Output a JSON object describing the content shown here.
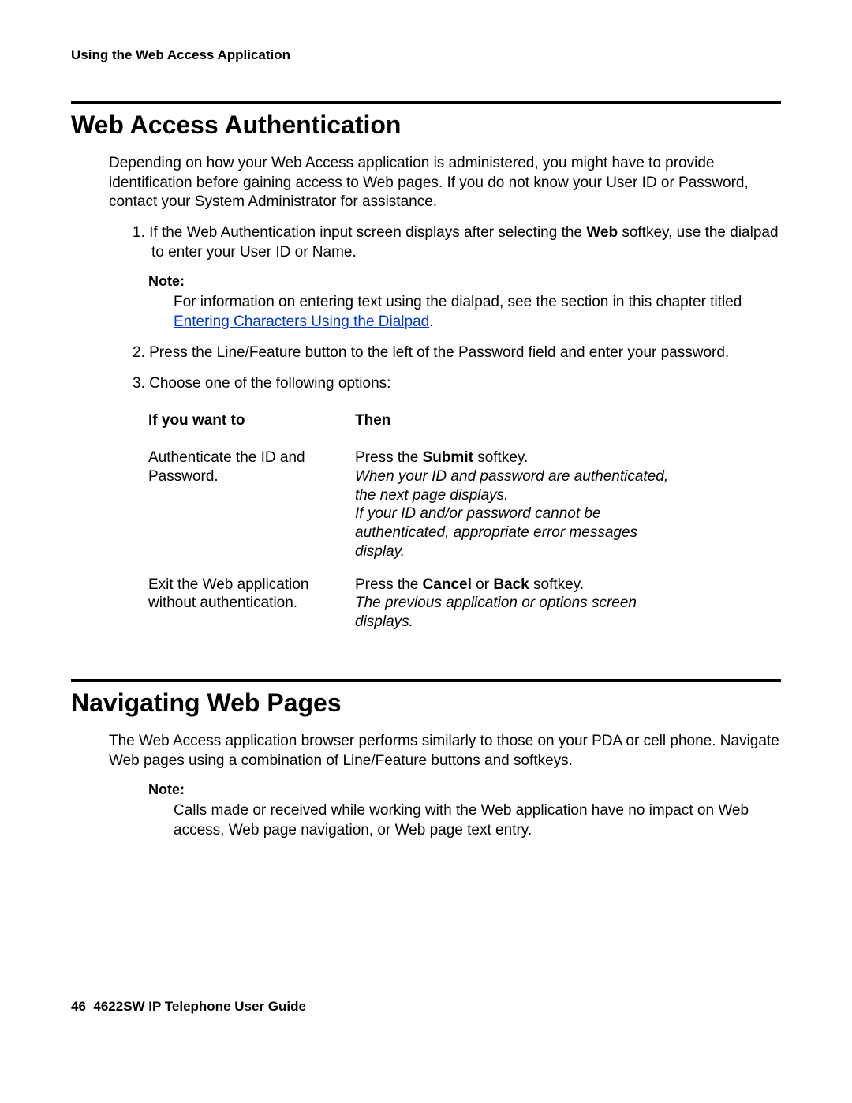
{
  "runningHeader": "Using the Web Access Application",
  "section1": {
    "title": "Web Access Authentication",
    "intro": "Depending on how your Web Access application is administered, you might have to provide identification before gaining access to Web pages. If you do not know your User ID or Password, contact your System Administrator for assistance.",
    "step1_pre": "1. If the Web Authentication input screen displays after selecting the ",
    "step1_bold": "Web",
    "step1_post": " softkey, use the dialpad to enter your User ID or Name.",
    "noteLabel": "Note:",
    "noteBody_pre": "For information on entering text using the dialpad, see the section in this chapter titled ",
    "noteBody_link": "Entering Characters Using the Dialpad",
    "noteBody_post": ".",
    "step2": "2. Press the Line/Feature button to the left of the Password field and enter your password.",
    "step3": "3. Choose one of the following options:",
    "table": {
      "h1": "If you want to",
      "h2": "Then",
      "r1c1": "Authenticate the ID and Password.",
      "r1c2_pre": "Press the ",
      "r1c2_bold": "Submit",
      "r1c2_post": " softkey.",
      "r1c2_it1": "When your ID and password are authenticated, the next page displays.",
      "r1c2_it2": "If your ID and/or password cannot be authenticated, appropriate error messages display.",
      "r2c1": "Exit the Web application without authentication.",
      "r2c2_pre": "Press the ",
      "r2c2_bold1": "Cancel",
      "r2c2_mid": " or ",
      "r2c2_bold2": "Back",
      "r2c2_post": " softkey.",
      "r2c2_it": "The previous application or options screen displays."
    }
  },
  "section2": {
    "title": "Navigating Web Pages",
    "intro": "The Web Access application browser performs similarly to those on your PDA or cell phone. Navigate Web pages using a combination of Line/Feature buttons and softkeys.",
    "noteLabel": "Note:",
    "noteBody": "Calls made or received while working with the Web application have no impact on Web access, Web page navigation, or Web page text entry."
  },
  "footer": {
    "pageNum": "46",
    "title": "4622SW IP Telephone User Guide"
  }
}
